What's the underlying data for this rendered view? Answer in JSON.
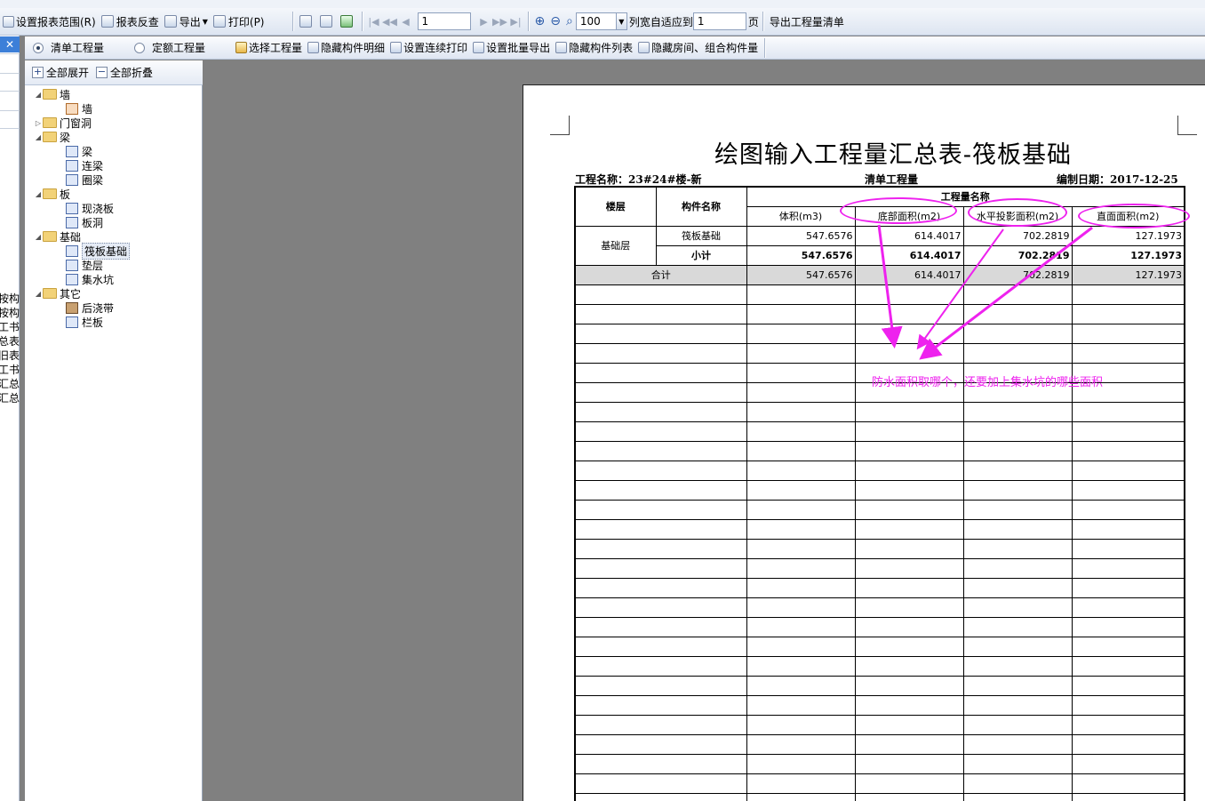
{
  "toolbar": {
    "report_range": "设置报表范围(R)",
    "report_check": "报表反查",
    "export": "导出",
    "print": "打印(P)",
    "page_number": "1",
    "zoom": "100",
    "fit_column": "列宽自适应到",
    "fit_pages": "1",
    "page_unit": "页",
    "export_bill": "导出工程量清单"
  },
  "toolbar2": {
    "radio_bill": "清单工程量",
    "radio_quota": "定额工程量",
    "select_quantity": "选择工程量",
    "hide_detail": "隐藏构件明细",
    "set_continuous_print": "设置连续打印",
    "set_batch_export": "设置批量导出",
    "hide_component_list": "隐藏构件列表",
    "hide_room": "隐藏房间、组合构件量"
  },
  "tree": {
    "expand_all": "全部展开",
    "collapse_all": "全部折叠",
    "groups": [
      {
        "label": "墙",
        "items": [
          "墙"
        ]
      },
      {
        "label": "门窗洞",
        "items": []
      },
      {
        "label": "梁",
        "items": [
          "梁",
          "连梁",
          "圈梁"
        ]
      },
      {
        "label": "板",
        "items": [
          "现浇板",
          "板洞"
        ]
      },
      {
        "label": "基础",
        "items": [
          "筏板基础",
          "垫层",
          "集水坑"
        ]
      },
      {
        "label": "其它",
        "items": [
          "后浇带",
          "栏板"
        ]
      }
    ]
  },
  "left_strip": [
    "按构",
    "按构",
    "工书",
    "总表",
    "旧表",
    "工书",
    "汇总",
    "汇总"
  ],
  "report": {
    "title": "绘图输入工程量汇总表-筏板基础",
    "project_label": "工程名称：23#24#楼-新",
    "type_label": "清单工程量",
    "date_label": "编制日期：2017-12-25",
    "headers": {
      "floor": "楼层",
      "component": "构件名称",
      "quantity_name": "工程量名称",
      "volume": "体积(m3)",
      "bottom_area": "底部面积(m2)",
      "projection_area": "水平投影面积(m2)",
      "side_area": "直面面积(m2)"
    },
    "floor_name": "基础层",
    "rows": [
      {
        "name": "筏板基础",
        "volume": "547.6576",
        "bottom": "614.4017",
        "projection": "702.2819",
        "side": "127.1973"
      },
      {
        "name": "小计",
        "volume": "547.6576",
        "bottom": "614.4017",
        "projection": "702.2819",
        "side": "127.1973"
      }
    ],
    "total": {
      "name": "合计",
      "volume": "547.6576",
      "bottom": "614.4017",
      "projection": "702.2819",
      "side": "127.1973"
    }
  },
  "annotation": "防水面积取哪个，还要加上集水坑的哪些面积",
  "colors": {
    "annotation": "#ee22ee",
    "toolbar": "#dde5f1",
    "workspace": "#808080"
  }
}
